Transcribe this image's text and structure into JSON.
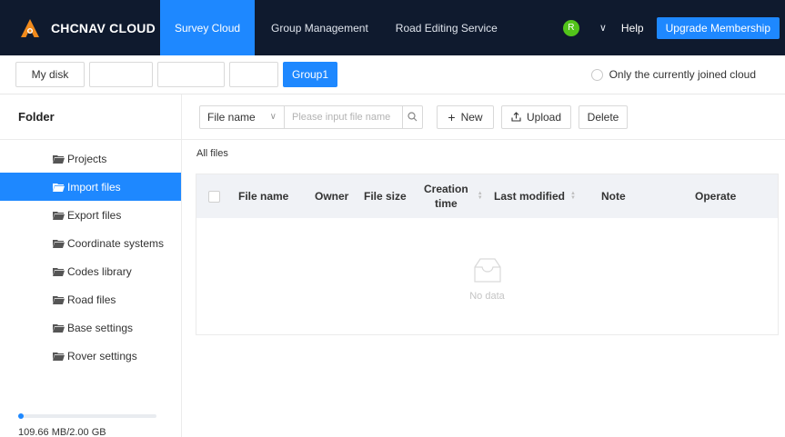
{
  "header": {
    "brand": "CHCNAV CLOUD",
    "nav": [
      "Survey Cloud",
      "Group Management",
      "Road Editing Service"
    ],
    "avatar_initial": "R",
    "help": "Help",
    "upgrade": "Upgrade Membership"
  },
  "diskbar": {
    "my_disk": "My disk",
    "group": "Group1",
    "radio_label": "Only the currently joined cloud"
  },
  "sidebar": {
    "title": "Folder",
    "items": [
      "Projects",
      "Import files",
      "Export files",
      "Coordinate systems",
      "Codes library",
      "Road files",
      "Base settings",
      "Rover settings"
    ],
    "active_index": 1,
    "usage_text": "109.66 MB/2.00 GB"
  },
  "toolbar": {
    "field": "File name",
    "search_placeholder": "Please input file name",
    "new": "New",
    "upload": "Upload",
    "delete": "Delete"
  },
  "breadcrumb": "All files",
  "table": {
    "columns": [
      "File name",
      "Owner",
      "File size",
      "Creation time",
      "Last modified",
      "Note",
      "Operate"
    ],
    "creation_line1": "Creation",
    "creation_line2": "time",
    "empty_text": "No data"
  },
  "colors": {
    "accent": "#1e88ff",
    "topbar": "#0f1a2e",
    "avatar": "#52c41a"
  }
}
